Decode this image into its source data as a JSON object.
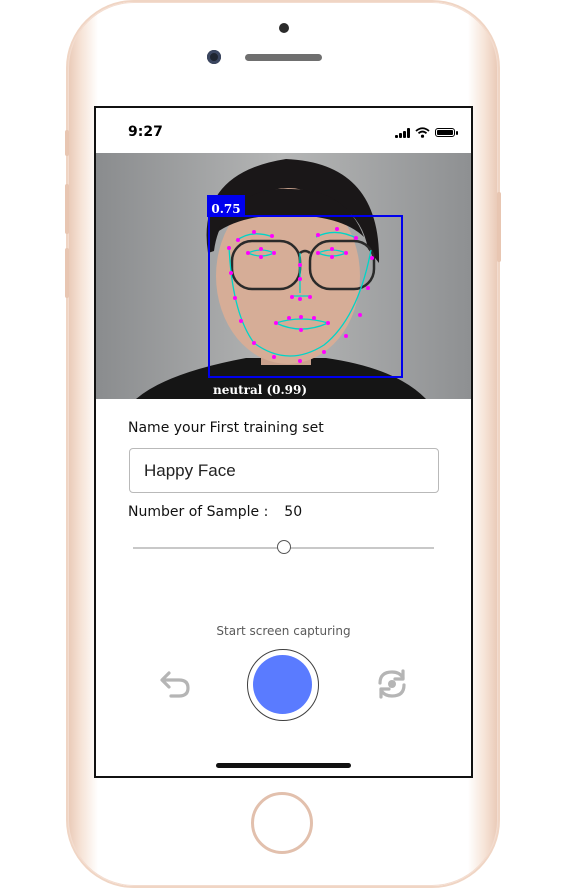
{
  "status_bar": {
    "time": "9:27"
  },
  "camera": {
    "detection_score": "0.75",
    "emotion": "neutral (0.99)",
    "box_color": "#0000ee",
    "landmark_color": "#ff00ff",
    "mesh_color": "#00d4c8"
  },
  "form": {
    "set_label": "Name your First training set",
    "set_name_value": "Happy Face",
    "samples_label": "Number of Sample :",
    "samples_value": "50",
    "slider_fraction": 0.5
  },
  "capture": {
    "label": "Start screen capturing",
    "undo_icon": "undo-icon",
    "switch_icon": "switch-camera-icon",
    "shutter_color": "#5a7bff"
  }
}
